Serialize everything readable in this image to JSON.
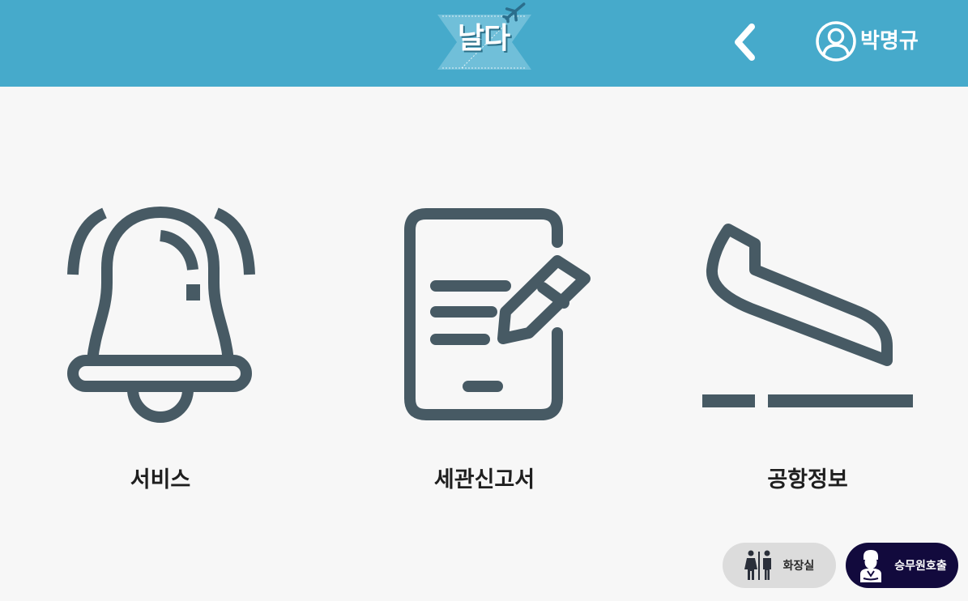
{
  "header": {
    "logo_text": "날다",
    "background_color": "#46aacb",
    "back_icon": "chevron-left-icon",
    "user_icon": "user-icon",
    "user_name": "박명규"
  },
  "menu": {
    "items": [
      {
        "label": "서비스",
        "icon": "bell-icon"
      },
      {
        "label": "세관신고서",
        "icon": "document-pen-icon"
      },
      {
        "label": "공항정보",
        "icon": "plane-takeoff-icon"
      }
    ],
    "icon_color": "#475a64"
  },
  "floating": {
    "restroom_label": "화장실",
    "restroom_icon": "restroom-icon",
    "crew_label": "승무원호출",
    "crew_icon": "flight-attendant-icon",
    "crew_color": "#120a3d"
  }
}
